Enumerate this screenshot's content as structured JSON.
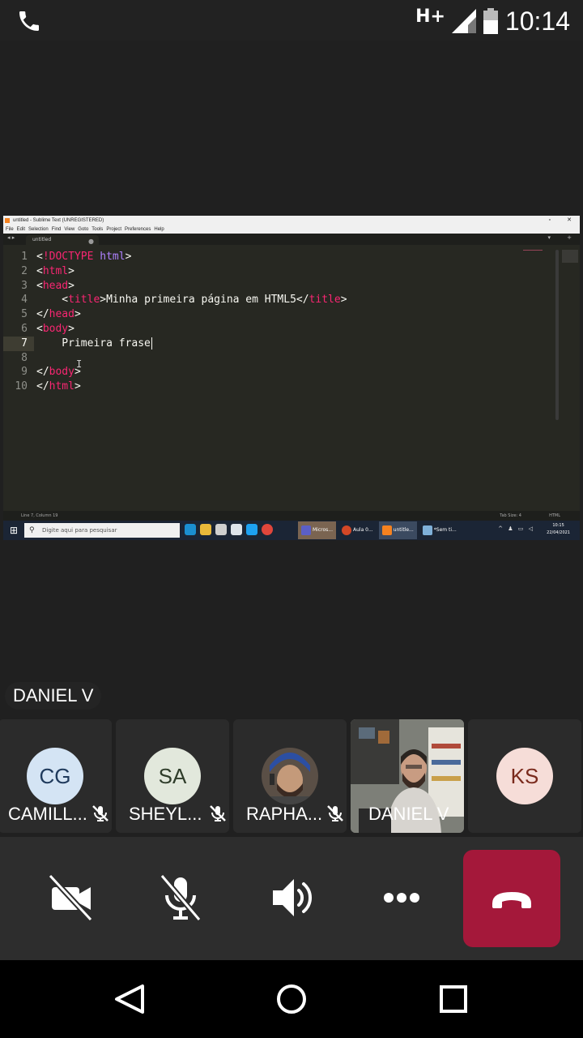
{
  "status_bar": {
    "network": "H+",
    "time": "10:14",
    "icons": [
      "phone-call-icon",
      "signal-icon",
      "battery-icon"
    ]
  },
  "shared_screen": {
    "window_title": "untitled - Sublime Text (UNREGISTERED)",
    "menu": [
      "File",
      "Edit",
      "Selection",
      "Find",
      "View",
      "Goto",
      "Tools",
      "Project",
      "Preferences",
      "Help"
    ],
    "tab_name": "untitled",
    "line_numbers": [
      "1",
      "2",
      "3",
      "4",
      "5",
      "6",
      "7",
      "8",
      "9",
      "10"
    ],
    "code_lines": [
      "<!DOCTYPE html>",
      "<html>",
      "<head>",
      "<title>Minha primeira página em HTML5</title>",
      "</head>",
      "<body>",
      "Primeira frase",
      "",
      "</body>",
      "</html>"
    ],
    "status_left": "Line 7, Column 19",
    "status_tab_size": "Tab Size: 4",
    "status_syntax": "HTML",
    "taskbar": {
      "search_placeholder": "Digite aqui para pesquisar",
      "apps": [
        "Micros...",
        "Aula 0...",
        "untitle...",
        "*Sem ti..."
      ],
      "clock_time": "10:15",
      "clock_date": "22/04/2021"
    }
  },
  "active_speaker": "DANIEL V",
  "participants": [
    {
      "initials": "CG",
      "name": "CAMILL...",
      "avatar_color": "#d4e4f4",
      "text_color": "#1f3a5c",
      "muted": true
    },
    {
      "initials": "SA",
      "name": "SHEYL...",
      "avatar_color": "#e2e8dc",
      "text_color": "#2f3d2a",
      "muted": true
    },
    {
      "initials": "",
      "name": "RAPHA...",
      "avatar_color": "#6b5d52",
      "text_color": "#ffffff",
      "muted": true
    },
    {
      "initials": "",
      "name": "DANIEL V",
      "avatar_color": "#8c8c88",
      "text_color": "#ffffff",
      "muted": false
    },
    {
      "initials": "KS",
      "name": "",
      "avatar_color": "#f6ddd8",
      "text_color": "#7a2a1c",
      "muted": false
    }
  ],
  "controls": [
    "camera-off-icon",
    "mic-off-icon",
    "speaker-icon",
    "more-icon",
    "hang-up-icon"
  ],
  "colors": {
    "hangup": "#a4183a",
    "tag": "#f92672",
    "keyword": "#ae81ff"
  }
}
